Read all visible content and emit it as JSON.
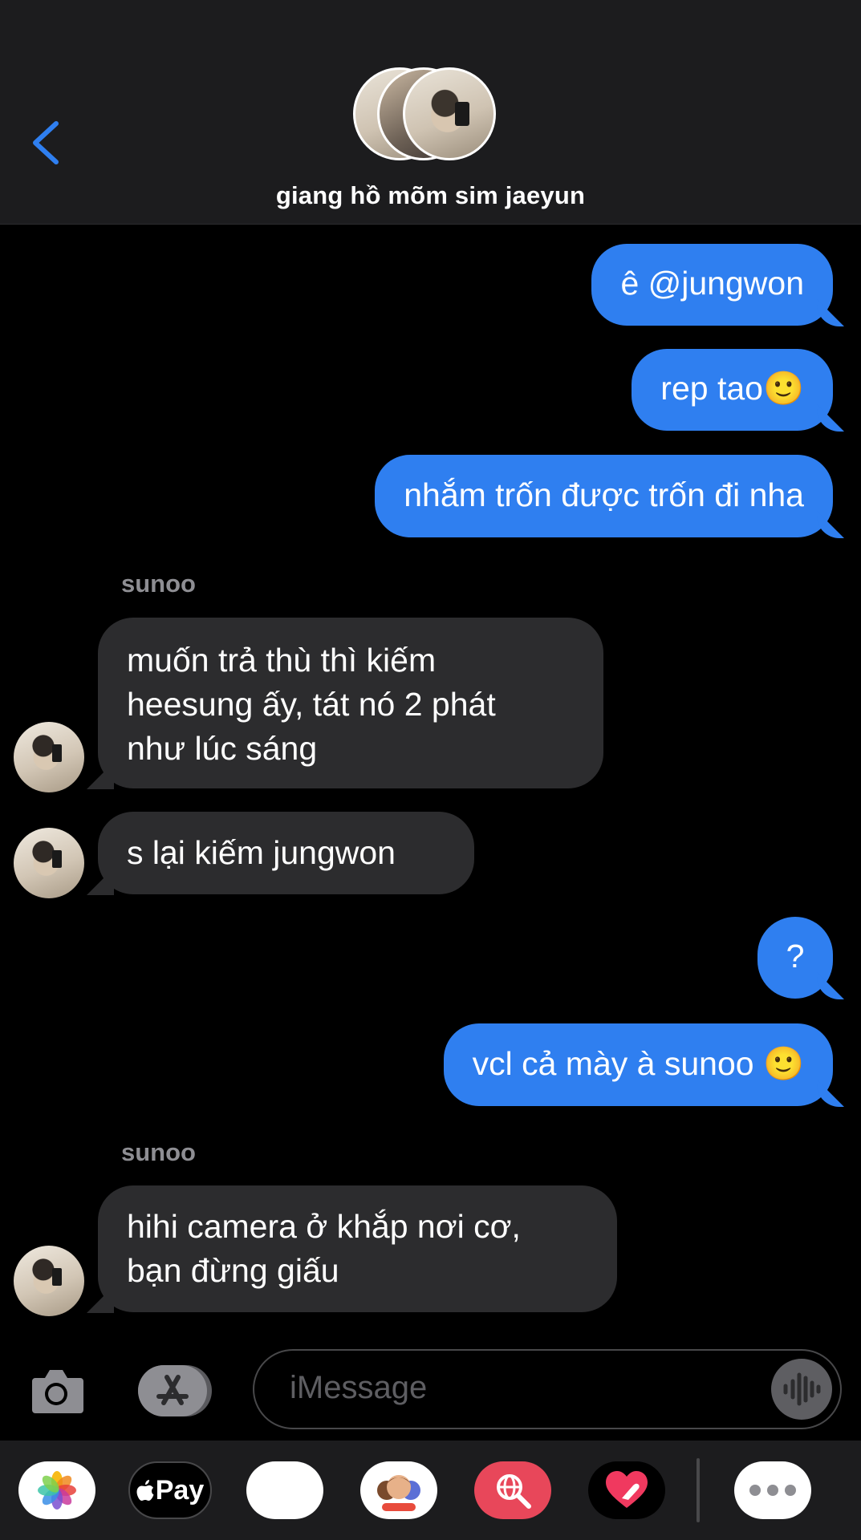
{
  "header": {
    "group_name": "giang hồ mõm sim jaeyun",
    "back_icon": "chevron-left-icon",
    "accent": "#2f7ff0"
  },
  "messages": [
    {
      "type": "out",
      "text": "ê @jungwon"
    },
    {
      "type": "out",
      "text": "rep tao🙂"
    },
    {
      "type": "out",
      "text": "nhắm trốn được trốn đi nha"
    },
    {
      "type": "sender",
      "text": "sunoo"
    },
    {
      "type": "in",
      "lines": [
        "muốn trả thù thì kiếm",
        "heesung ấy, tát nó 2 phát",
        "như lúc sáng"
      ]
    },
    {
      "type": "in",
      "text": "s lại kiếm jungwon"
    },
    {
      "type": "out",
      "text": "?"
    },
    {
      "type": "out",
      "text": "vcl cả mày à sunoo 🙂"
    },
    {
      "type": "sender",
      "text": "sunoo"
    },
    {
      "type": "in",
      "lines": [
        "hihi camera ở khắp nơi cơ,",
        "bạn đừng giấu"
      ]
    }
  ],
  "input": {
    "placeholder": "iMessage",
    "camera_icon": "camera-icon",
    "appstore_icon": "app-store-icon",
    "mic_icon": "audio-waveform-icon"
  },
  "apps": {
    "photos_icon": "photos-icon",
    "applepay_label": "Pay",
    "memoji_monkey": "🐵",
    "memoji_people": "🧑‍🤝‍🧑",
    "search_icon": "image-search-icon",
    "digital_touch_icon": "digital-touch-icon",
    "more_icon": "more-icon"
  }
}
